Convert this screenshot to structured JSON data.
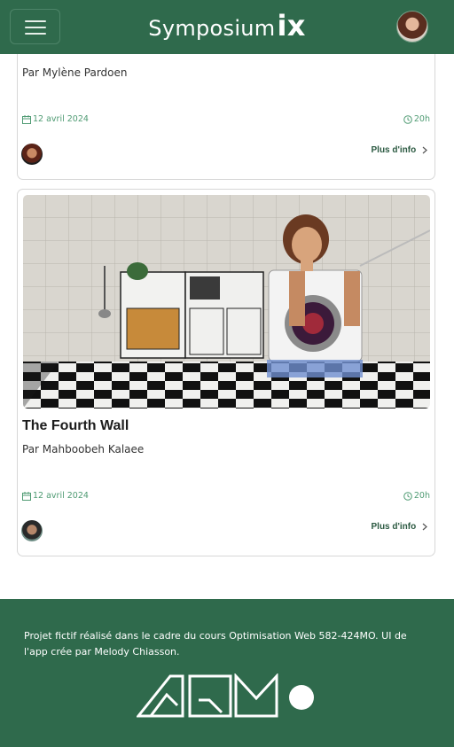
{
  "header": {
    "brand_name": "Symposium",
    "brand_suffix": "ix",
    "menu_label": "Menu"
  },
  "cards": [
    {
      "title": "",
      "author": "Par Mylène Pardoen",
      "date": "12 avril 2024",
      "duration": "20h",
      "more_label": "Plus d'info"
    },
    {
      "title": "The Fourth Wall",
      "author": "Par Mahboobeh Kalaee",
      "date": "12 avril 2024",
      "duration": "20h",
      "more_label": "Plus d'info"
    }
  ],
  "footer": {
    "text": "Projet fictif réalisé dans le cadre du cours Optimisation Web 582-424MO. UI de l'app crée par Melody Chiasson."
  },
  "colors": {
    "brand_green": "#2f6a4c",
    "accent_green": "#4f9b73",
    "link_green": "#2c5a42"
  },
  "icons": [
    "menu-icon",
    "calendar-icon",
    "clock-icon",
    "chevron-right-icon",
    "aqm-logo"
  ]
}
